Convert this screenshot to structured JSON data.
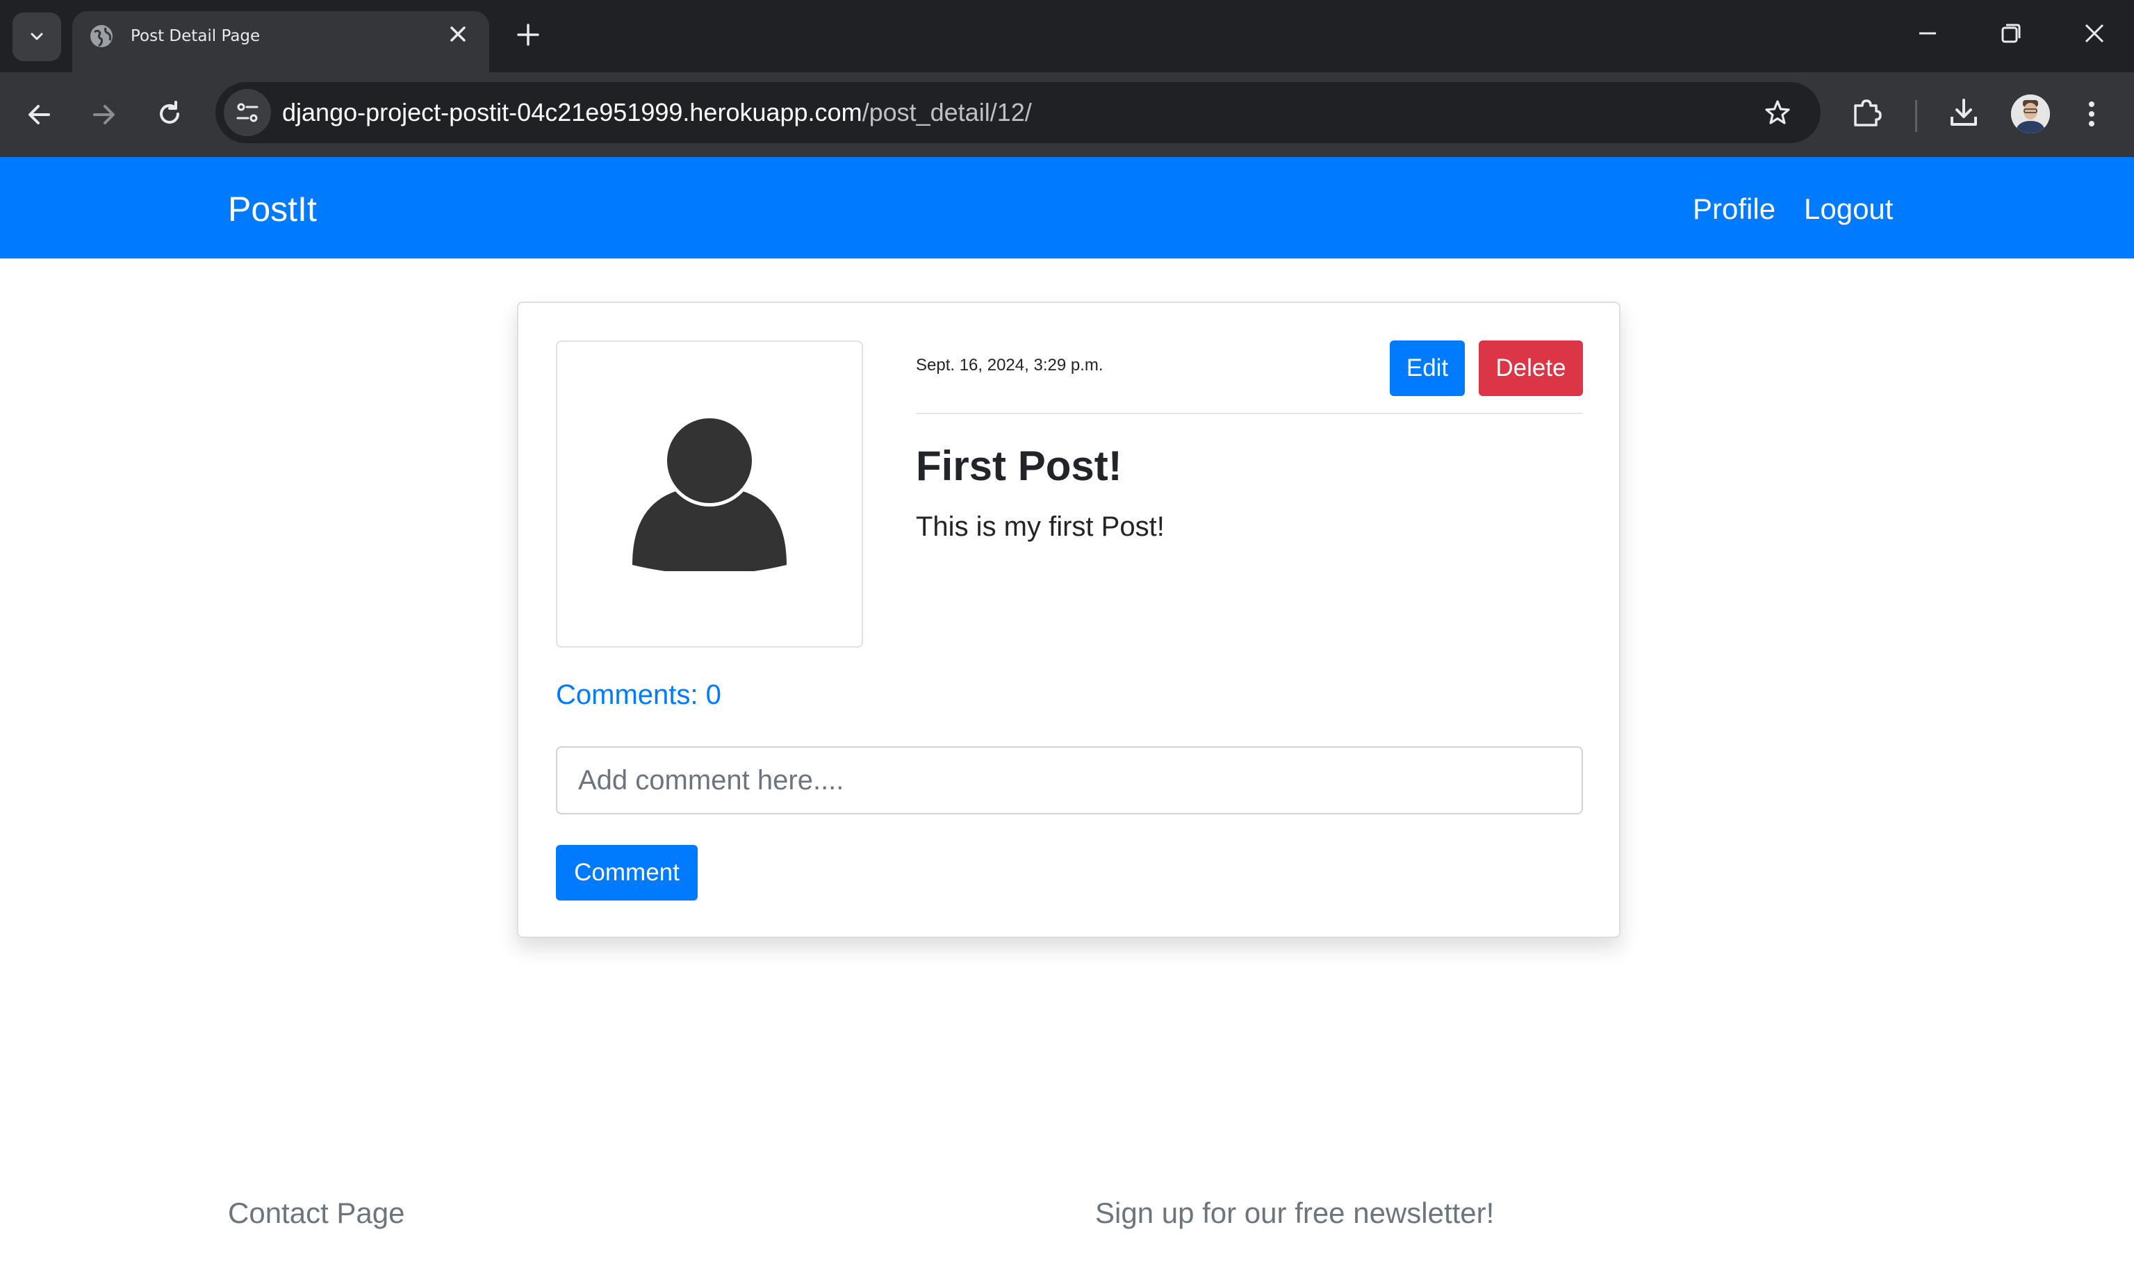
{
  "browser": {
    "tab": {
      "title": "Post Detail Page"
    },
    "omnibox": {
      "host": "django-project-postit-04c21e951999.herokuapp.com",
      "path": "/post_detail/12/"
    }
  },
  "navbar": {
    "brand": "PostIt",
    "links": {
      "profile": "Profile",
      "logout": "Logout"
    }
  },
  "post": {
    "date": "Sept. 16, 2024, 3:29 p.m.",
    "title": "First Post!",
    "body": "This is my first Post!",
    "actions": {
      "edit": "Edit",
      "delete": "Delete"
    }
  },
  "comments": {
    "count_label": "Comments: 0",
    "input_placeholder": "Add comment here....",
    "submit_label": "Comment"
  },
  "footer": {
    "contact": "Contact Page",
    "newsletter": "Sign up for our free newsletter!"
  },
  "colors": {
    "primary": "#007bff",
    "danger": "#dc3545",
    "text": "#212529",
    "muted": "#6c757d",
    "chrome_dark": "#202124",
    "chrome_toolbar": "#35363a"
  }
}
